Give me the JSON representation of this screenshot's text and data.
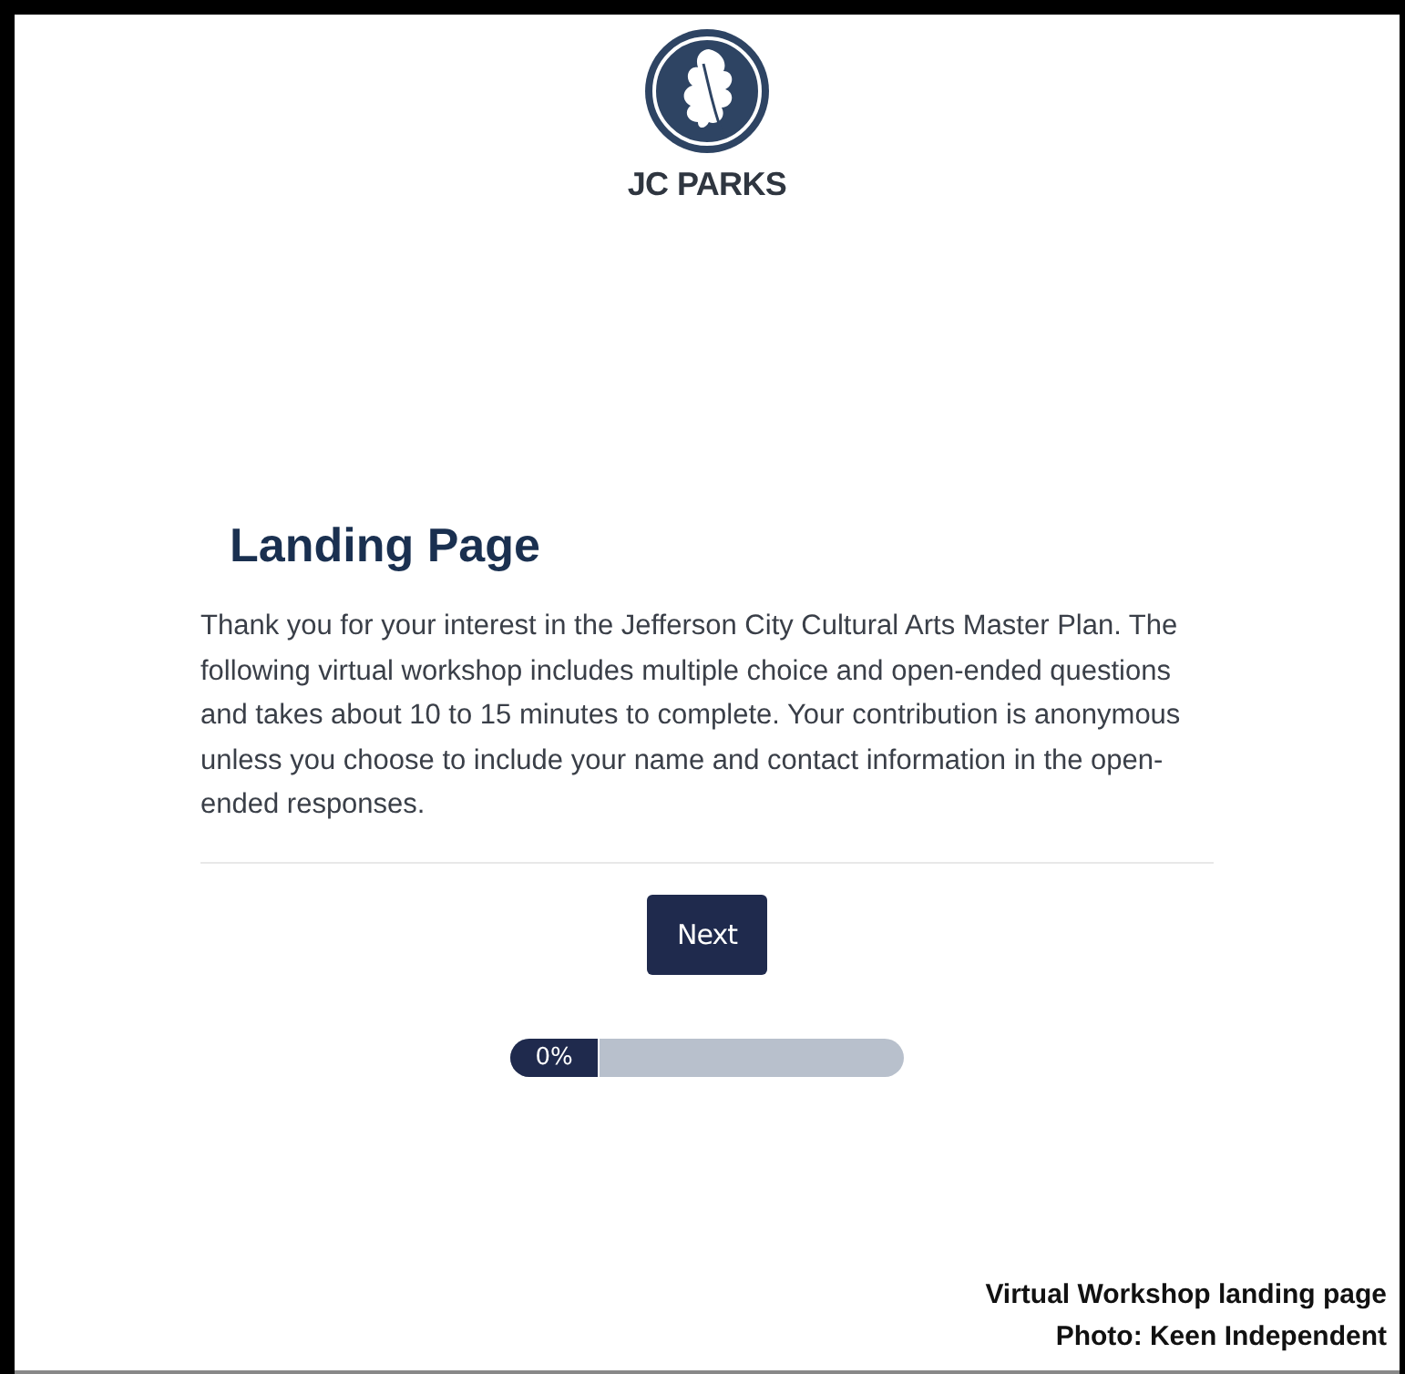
{
  "logo": {
    "name": "JC PARKS"
  },
  "heading": "Landing Page",
  "intro": "Thank you for your interest in the Jefferson City Cultural Arts Master Plan. The following virtual workshop includes multiple choice and open-ended questions and takes about 10 to 15 minutes to complete. Your contribution is anonymous unless you choose to include your name and contact information in the open-ended responses.",
  "next_button": "Next",
  "progress": {
    "reading": "0%"
  },
  "caption": [
    "Virtual Workshop landing page",
    "Photo: Keen Independent"
  ]
}
